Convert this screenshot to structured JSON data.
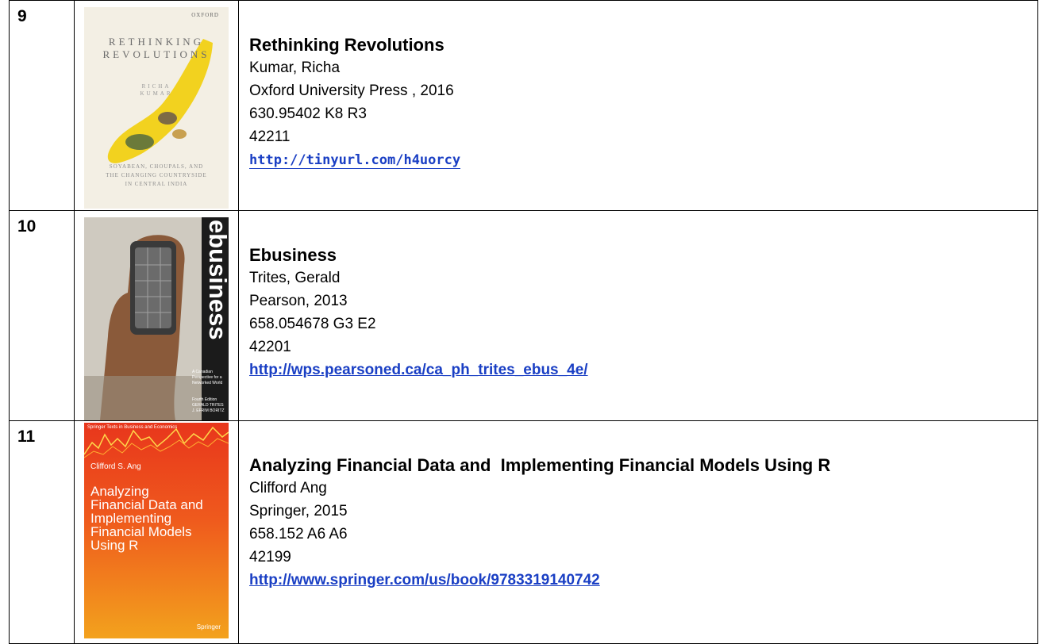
{
  "books": [
    {
      "num": "9",
      "title": "Rethinking Revolutions",
      "author": "Kumar, Richa",
      "publisher": "Oxford University Press , 2016",
      "call_number": "630.95402 K8 R3",
      "acc_no": "42211",
      "link": "http://tinyurl.com/h4uorcy",
      "cover": {
        "publisher_mark": "OXFORD",
        "title_line1": "RETHINKING",
        "title_line2": "REVOLUTIONS",
        "author_line1": "RICHA",
        "author_line2": "KUMAR",
        "subtitle_line1": "SOYABEAN, CHOUPALS, AND",
        "subtitle_line2": "THE CHANGING COUNTRYSIDE",
        "subtitle_line3": "IN CENTRAL INDIA"
      }
    },
    {
      "num": "10",
      "title": "Ebusiness",
      "author": "Trites, Gerald",
      "publisher": "Pearson, 2013",
      "call_number": "658.054678 G3 E2",
      "acc_no": "42201",
      "link": "http://wps.pearsoned.ca/ca_ph_trites_ebus_4e/",
      "cover": {
        "spine_title": "ebusiness",
        "tagline_line1": "A Canadian",
        "tagline_line2": "Perspective for a",
        "tagline_line3": "Networked World",
        "edition": "Fourth Edition",
        "authors_line1": "GERALD TRITES",
        "authors_line2": "J. EFRIM BORITZ"
      }
    },
    {
      "num": "11",
      "title": "Analyzing Financial Data and  Implementing Financial Models Using R",
      "author": "Clifford Ang",
      "publisher": "Springer, 2015",
      "call_number": "658.152 A6 A6",
      "acc_no": "42199",
      "link": "http://www.springer.com/us/book/9783319140742",
      "cover": {
        "series": "Springer Texts in Business and Economics",
        "author": "Clifford S. Ang",
        "title_line1": "Analyzing",
        "title_line2": "Financial Data and",
        "title_line3": "Implementing",
        "title_line4": "Financial Models",
        "title_line5": "Using R",
        "publisher_mark": "Springer"
      }
    }
  ],
  "colors": {
    "link": "#1a3fc4",
    "border": "#000000",
    "springer_orange": "#ef5a1d"
  }
}
